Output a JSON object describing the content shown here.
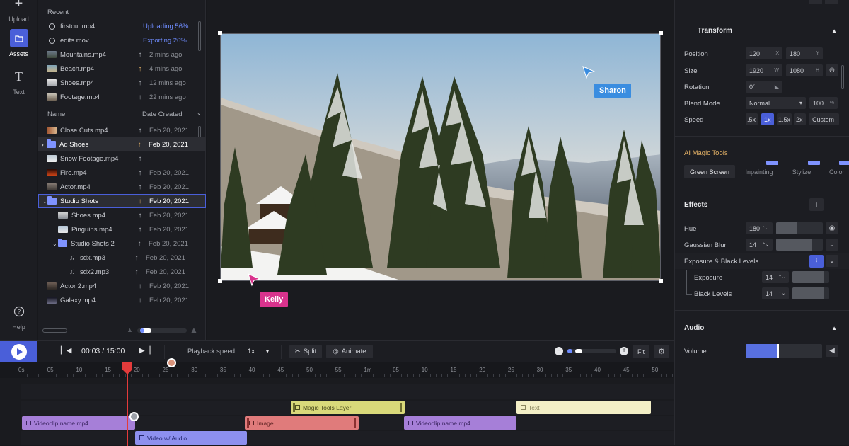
{
  "nav": {
    "upload_label": "Upload",
    "assets_label": "Assets",
    "text_label": "Text",
    "help_label": "Help"
  },
  "assets": {
    "recent_header": "Recent",
    "recent": [
      {
        "name": "firstcut.mp4",
        "status": "Uploading 56%"
      },
      {
        "name": "edits.mov",
        "status": "Exporting 26%"
      },
      {
        "name": "Mountains.mp4",
        "time": "2 mins ago"
      },
      {
        "name": "Beach.mp4",
        "time": "4 mins ago"
      },
      {
        "name": "Shoes.mp4",
        "time": "12 mins ago"
      },
      {
        "name": "Footage.mp4",
        "time": "22 mins ago"
      }
    ],
    "col_name": "Name",
    "col_date": "Date Created",
    "files": [
      {
        "name": "Close Cuts.mp4",
        "date": "Feb 20, 2021"
      },
      {
        "name": "Ad Shoes",
        "date": "Feb 20, 2021"
      },
      {
        "name": "Snow Footage.mp4",
        "date": ""
      },
      {
        "name": "Fire.mp4",
        "date": "Feb 20, 2021"
      },
      {
        "name": "Actor.mp4",
        "date": "Feb 20, 2021"
      },
      {
        "name": "Studio Shots",
        "date": "Feb 20, 2021"
      },
      {
        "name": "Shoes.mp4",
        "date": "Feb 20, 2021"
      },
      {
        "name": "Pinguins.mp4",
        "date": "Feb 20, 2021"
      },
      {
        "name": "Studio Shots 2",
        "date": "Feb 20, 2021"
      },
      {
        "name": "sdx.mp3",
        "date": "Feb 20, 2021"
      },
      {
        "name": "sdx2.mp3",
        "date": "Feb 20, 2021"
      },
      {
        "name": "Actor 2.mp4",
        "date": "Feb 20, 2021"
      },
      {
        "name": "Galaxy.mp4",
        "date": "Feb 20, 2021"
      }
    ]
  },
  "preview": {
    "collaborators": [
      "Sharon",
      "Kelly"
    ]
  },
  "properties": {
    "transform_title": "Transform",
    "position_label": "Position",
    "position_x": "120",
    "position_y": "180",
    "size_label": "Size",
    "size_w": "1920",
    "size_h": "1080",
    "rotation_label": "Rotation",
    "rotation_value": "0˚",
    "blend_label": "Blend Mode",
    "blend_value": "Normal",
    "blend_pct": "100",
    "speed_label": "Speed",
    "speed_options": [
      ".5x",
      "1x",
      "1.5x",
      "2x",
      "Custom"
    ],
    "ai_title": "AI Magic Tools",
    "ai_tabs": [
      "Green Screen",
      "Inpainting",
      "Stylize",
      "Colori"
    ],
    "effects_title": "Effects",
    "hue_label": "Hue",
    "hue_value": "180",
    "hue_level": 0.45,
    "blur_label": "Gaussian Blur",
    "blur_value": "14",
    "blur_level": 0.75,
    "exposure_group_label": "Exposure & Black Levels",
    "exposure_label": "Exposure",
    "exposure_value": "14",
    "exposure_level": 0.85,
    "black_label": "Black Levels",
    "black_value": "14",
    "black_level": 0.85,
    "audio_title": "Audio",
    "volume_label": "Volume",
    "volume_level": 0.43
  },
  "transport": {
    "timecode": "00:03 / 15:00",
    "speed_label": "Playback speed:",
    "speed_value": "1x",
    "split_label": "Split",
    "animate_label": "Animate",
    "fit_label": "Fit",
    "zoom_level": 0.2
  },
  "timeline": {
    "ticks": [
      "0s",
      "05",
      "10",
      "15",
      "20",
      "25",
      "30",
      "35",
      "40",
      "45",
      "50",
      "55",
      "1m",
      "05",
      "10",
      "15",
      "20",
      "25",
      "30",
      "35",
      "40",
      "45",
      "50"
    ],
    "clips": [
      {
        "label": "Magic Tools Layer",
        "kind": "ai"
      },
      {
        "label": "Text",
        "kind": "text"
      },
      {
        "label": "Videoclip name.mp4",
        "kind": "video"
      },
      {
        "label": "Image",
        "kind": "image"
      },
      {
        "label": "Videoclip name.mp4",
        "kind": "video"
      },
      {
        "label": "Video w/ Audio",
        "kind": "audio"
      }
    ]
  }
}
